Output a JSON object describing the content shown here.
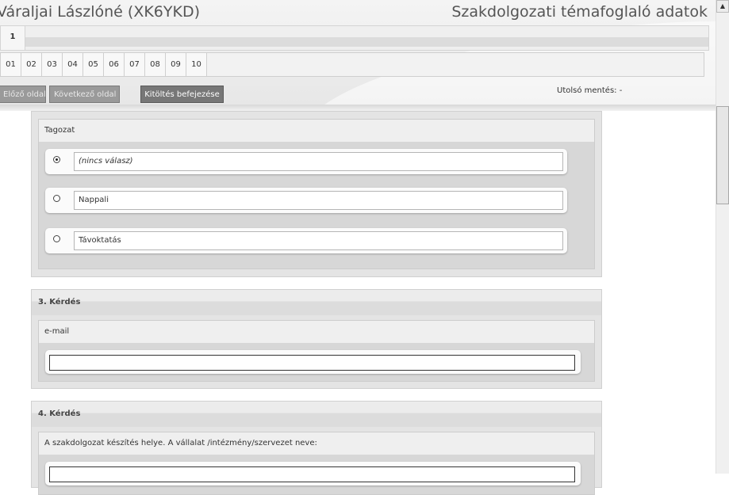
{
  "header": {
    "user_title": "Váraljai Lászlóné (XK6YKD)",
    "form_title": "Szakdolgozati témafoglaló adatok",
    "page_tab": "1",
    "question_numbers": [
      "01",
      "02",
      "03",
      "04",
      "05",
      "06",
      "07",
      "08",
      "09",
      "10"
    ],
    "prev_button": "Előző oldal",
    "next_button": "Következő oldal",
    "finish_button": "Kitöltés befejezése",
    "last_save": "Utolsó mentés: -"
  },
  "questions": {
    "tagozat": {
      "label": "Tagozat",
      "options": [
        {
          "label": "(nincs válasz)",
          "checked": true
        },
        {
          "label": "Nappali",
          "checked": false
        },
        {
          "label": "Távoktatás",
          "checked": false
        }
      ]
    },
    "q3": {
      "number": "3. Kérdés",
      "label": "e-mail",
      "value": ""
    },
    "q4": {
      "number": "4. Kérdés",
      "label": "A szakdolgozat készítés helye. A vállalat /intézmény/szervezet neve:",
      "value": ""
    }
  },
  "scrollbar": {
    "up_icon": "up-arrow-icon"
  },
  "colors": {
    "button_disabled": "#9a9a9a",
    "button_active": "#777777",
    "panel_bg": "#e4e4e4"
  }
}
